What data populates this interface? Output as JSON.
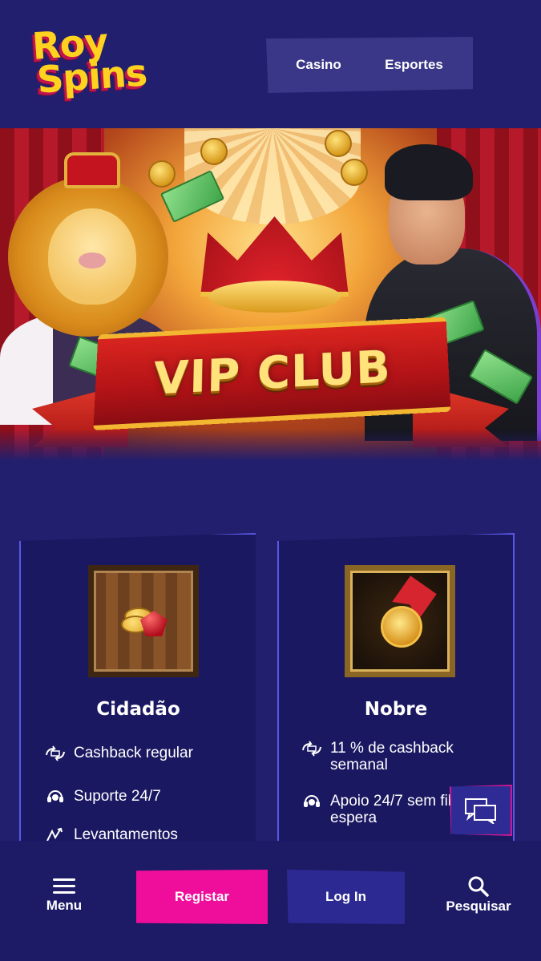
{
  "header": {
    "logo_line1": "Roy",
    "logo_line2": "Spins",
    "nav": [
      {
        "label": "Casino"
      },
      {
        "label": "Esportes"
      }
    ]
  },
  "hero": {
    "banner_text": "VIP CLUB"
  },
  "tiers": [
    {
      "title": "Cidadão",
      "perks": [
        {
          "icon": "cashback-icon",
          "text": "Cashback regular"
        },
        {
          "icon": "support-icon",
          "text": "Suporte 24/7"
        },
        {
          "icon": "withdrawal-icon",
          "text": "Levantamentos"
        }
      ]
    },
    {
      "title": "Nobre",
      "perks": [
        {
          "icon": "cashback-icon",
          "text": "11 % de cashback semanal"
        },
        {
          "icon": "support-icon",
          "text": "Apoio 24/7 sem fila de espera"
        }
      ]
    }
  ],
  "bottom_nav": {
    "menu_label": "Menu",
    "register_label": "Registar",
    "login_label": "Log In",
    "search_label": "Pesquisar"
  },
  "colors": {
    "background": "#221f6e",
    "register_button": "#ef0e9b",
    "login_button": "#2c2992",
    "logo_yellow": "#ffd21f"
  }
}
